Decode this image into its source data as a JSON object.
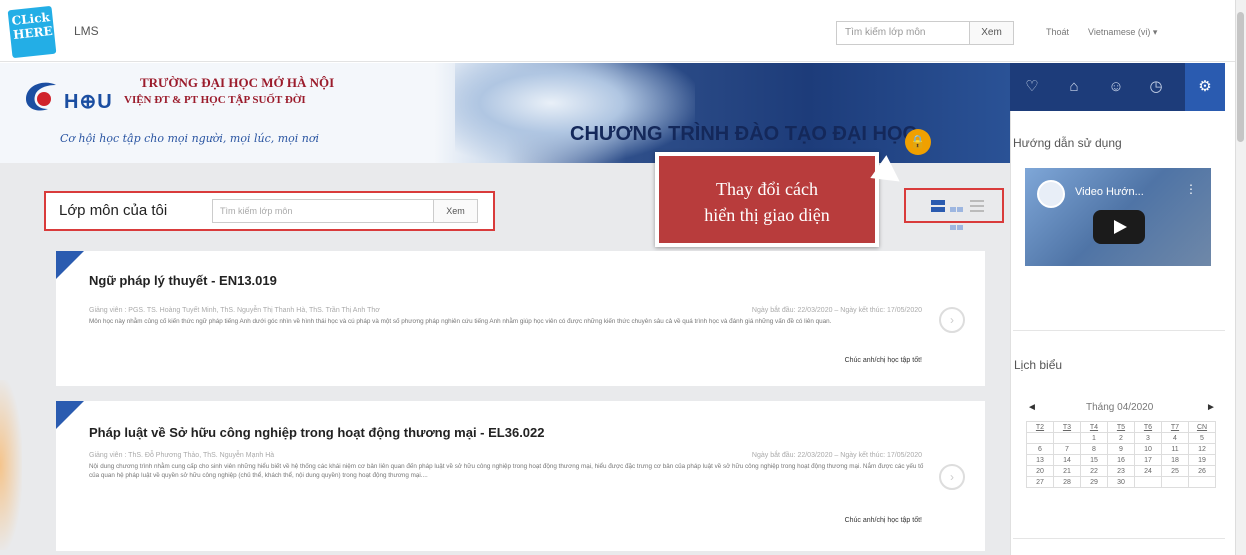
{
  "topbar": {
    "click_here_line1": "CLick",
    "click_here_line2": "HERE",
    "app_name": "LMS",
    "search_placeholder": "Tìm kiếm lớp môn",
    "search_button": "Xem",
    "logout": "Thoát",
    "language": "Vietnamese (vi) ▾"
  },
  "banner": {
    "hou_logo_text": "H⊕U",
    "university_line1": "TRƯỜNG ĐẠI HỌC MỞ HÀ NỘI",
    "university_line2": "VIỆN ĐT & PT HỌC TẬP SUỐT ĐỜI",
    "slogan": "Cơ hội học tập cho mọi người, mọi lúc, mọi nơi",
    "program_title": "CHƯƠNG TRÌNH ĐÀO TẠO ĐẠI HỌC"
  },
  "my_courses": {
    "label": "Lớp môn của tôi",
    "search_placeholder": "Tìm kiếm lớp môn",
    "search_button": "Xem"
  },
  "tooltip": {
    "line1": "Thay đổi cách",
    "line2": "hiển thị giao diện"
  },
  "courses": [
    {
      "title": "Ngữ pháp lý thuyết - EN13.019",
      "teachers": "Giảng viên : PGS. TS. Hoàng Tuyết Minh, ThS. Nguyễn Thị Thanh Hà, ThS. Trần Thị Anh Thơ",
      "dates": "Ngày bắt đầu: 22/03/2020 – Ngày kết thúc: 17/05/2020",
      "description": "Môn học này nhằm củng cố kiến thức ngữ pháp tiếng Anh dưới góc nhìn về hình thái học và cú pháp và một số phương pháp nghiên cứu tiếng Anh nhằm giúp học viên có được những kiến thức chuyên sâu cả về quá trình học và đánh giá những vấn đề có liên quan.",
      "wish": "Chúc anh/chị học tập tốt!"
    },
    {
      "title": "Pháp luật về Sở hữu công nghiệp trong hoạt động thương mại - EL36.022",
      "teachers": "Giảng viên : ThS. Đỗ Phương Thảo, ThS. Nguyễn Mạnh Hà",
      "dates": "Ngày bắt đầu: 22/03/2020 – Ngày kết thúc: 17/05/2020",
      "description": "Nội dung chương trình nhằm cung cấp cho sinh viên những hiểu biết về hệ thống các khái niệm cơ bản liên quan đến pháp luật về sở hữu công nghiệp trong hoạt động thương mại, hiểu được đặc trưng cơ bản của pháp luật về sở hữu công nghiệp trong hoạt động thương mại. Nắm được các yếu tố của quan hệ pháp luật về quyền sở hữu công nghiệp (chủ thể, khách thể, nội dung quyền) trong hoạt động thương mại....",
      "wish": "Chúc anh/chị học tập tốt!"
    }
  ],
  "sidebar": {
    "guide_title": "Hướng dẫn sử dụng",
    "video_title": "Video Hướn...",
    "calendar_title": "Lịch biểu",
    "calendar_month": "Tháng 04/2020",
    "calendar_prev": "◄",
    "calendar_next": "►",
    "weekdays": [
      "T2",
      "T3",
      "T4",
      "T5",
      "T6",
      "T7",
      "CN"
    ],
    "weeks": [
      [
        "",
        "",
        "1",
        "2",
        "3",
        "4",
        "5"
      ],
      [
        "6",
        "7",
        "8",
        "9",
        "10",
        "11",
        "12"
      ],
      [
        "13",
        "14",
        "15",
        "16",
        "17",
        "18",
        "19"
      ],
      [
        "20",
        "21",
        "22",
        "23",
        "24",
        "25",
        "26"
      ],
      [
        "27",
        "28",
        "29",
        "30",
        "",
        "",
        ""
      ]
    ]
  },
  "colors": {
    "brand_blue": "#1d3c7a",
    "accent_blue": "#2a5bb0",
    "highlight_red": "#d93b3b",
    "tooltip_red": "#b83c3c"
  }
}
